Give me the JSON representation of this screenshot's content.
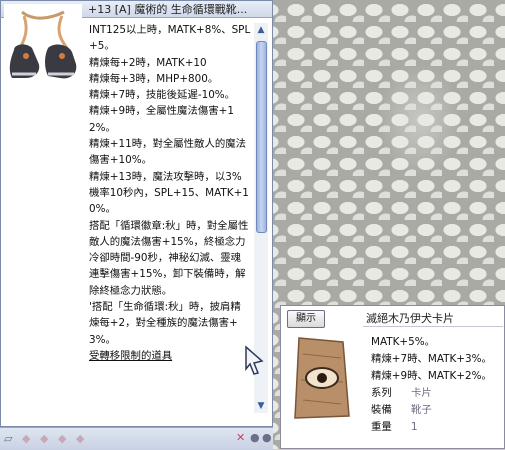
{
  "item": {
    "title": "+13 [A] 魔術的 生命循環戰靴...",
    "description": [
      "INT125以上時，MATK+8%、SPL+5。",
      "精煉每+2時，MATK+10",
      "精煉每+3時，MHP+800。",
      "精煉+7時，技能後延遲-10%。",
      "精煉+9時，全屬性魔法傷害+12%。",
      "精煉+11時，對全屬性敵人的魔法傷害+10%。",
      "精煉+13時，魔法攻擊時，以3%機率10秒內，SPL+15、MATK+10%。",
      "搭配「循環徽章:秋」時，對全屬性敵人的魔法傷害+15%，終極念力冷卻時間-90秒，神秘幻滅、靈魂連擊傷害+15%，卸下裝備時，解除終極念力狀態。",
      "'搭配「生命循環:秋」時，披肩精煉每+2，對全種族的魔法傷害+3%。"
    ],
    "restriction_link": "受轉移限制的道具"
  },
  "card": {
    "show_button": "顯示",
    "title": "滅絕木乃伊犬卡片",
    "effects": [
      "MATK+5%。",
      "精煉+7時、MATK+3%。",
      "精煉+9時、MATK+2%。"
    ],
    "attributes": [
      {
        "key": "系列",
        "value": "卡片"
      },
      {
        "key": "裝備",
        "value": "靴子"
      },
      {
        "key": "重量",
        "value": "1"
      }
    ]
  },
  "icons": {
    "scroll_up": "scroll-up-icon",
    "scroll_down": "scroll-down-icon",
    "close": "close-icon",
    "lock": "lock-icon"
  }
}
